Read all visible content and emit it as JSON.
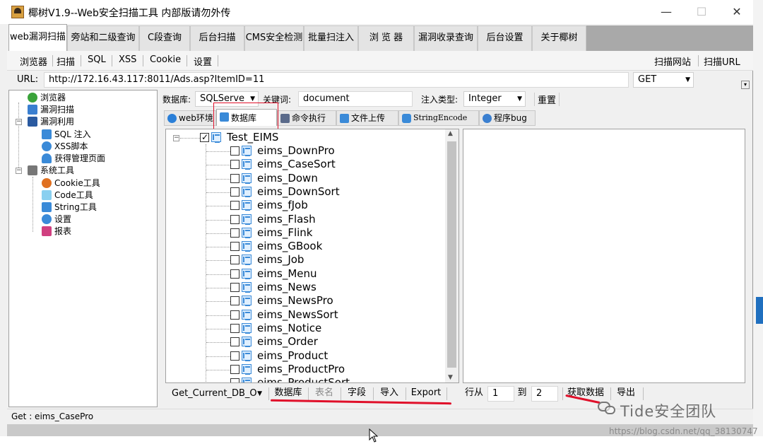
{
  "window": {
    "title": "椰树V1.9--Web安全扫描工具 内部版请勿外传",
    "minimize": "—",
    "maximize": "☐",
    "close": "✕"
  },
  "main_tabs": [
    {
      "label": "web漏洞扫描",
      "active": true
    },
    {
      "label": "旁站和二级查询"
    },
    {
      "label": "C段查询"
    },
    {
      "label": "后台扫描"
    },
    {
      "label": "CMS安全检测"
    },
    {
      "label": "批量扫注入"
    },
    {
      "label": "浏 览 器"
    },
    {
      "label": "漏洞收录查询"
    },
    {
      "label": "后台设置"
    },
    {
      "label": "关于椰树"
    }
  ],
  "toolbar": {
    "items": [
      "浏览器",
      "扫描",
      "SQL",
      "XSS",
      "Cookie",
      "设置"
    ],
    "right_items": [
      "扫描网站",
      "扫描URL"
    ]
  },
  "url_row": {
    "label": "URL:",
    "value": "http://172.16.43.117:8011/Ads.asp?ItemID=11",
    "method": "GET"
  },
  "nav_tree": {
    "items": [
      {
        "label": "浏览器",
        "icon": "check-circle-icon",
        "color": "#3aa33a"
      },
      {
        "label": "漏洞扫描",
        "icon": "scan-icon",
        "color": "#3a7fd0"
      },
      {
        "label": "漏洞利用",
        "icon": "exploit-icon",
        "color": "#2a5aa0"
      },
      {
        "label": "SQL 注入",
        "icon": "database-icon",
        "color": "#3a8ad8"
      },
      {
        "label": "XSS脚本",
        "icon": "xss-icon",
        "color": "#3a8ad8"
      },
      {
        "label": "获得管理页面",
        "icon": "user-icon",
        "color": "#3a8ad8"
      },
      {
        "label": "系统工具",
        "icon": "tools-icon",
        "color": "#666666"
      },
      {
        "label": "Cookie工具",
        "icon": "cookie-icon",
        "color": "#e07020"
      },
      {
        "label": "Code工具",
        "icon": "code-icon",
        "color": "#8ad0f0"
      },
      {
        "label": "String工具",
        "icon": "string-icon",
        "color": "#3a8ad8"
      },
      {
        "label": "设置",
        "icon": "gear-icon",
        "color": "#3a8ad8"
      },
      {
        "label": "报表",
        "icon": "report-icon",
        "color": "#d04080"
      }
    ]
  },
  "query_bar": {
    "db_label": "数据库:",
    "db_value": "SQLServe",
    "keyword_label": "关键词:",
    "keyword_value": "document",
    "inject_label": "注入类型:",
    "inject_value": "Integer",
    "reset_label": "重置"
  },
  "sub_tabs": [
    {
      "label": "web环境",
      "icon": "info-icon"
    },
    {
      "label": "数据库",
      "icon": "database-icon",
      "active": true
    },
    {
      "label": "命令执行",
      "icon": "terminal-icon"
    },
    {
      "label": "文件上传",
      "icon": "upload-icon"
    },
    {
      "label": "StringEncode",
      "icon": "encode-icon"
    },
    {
      "label": "程序bug",
      "icon": "bug-icon"
    }
  ],
  "db_tree": {
    "root": "Test_EIMS",
    "tables": [
      "eims_DownPro",
      "eims_CaseSort",
      "eims_Down",
      "eims_DownSort",
      "eims_fJob",
      "eims_Flash",
      "eims_Flink",
      "eims_GBook",
      "eims_Job",
      "eims_Menu",
      "eims_News",
      "eims_NewsPro",
      "eims_NewsSort",
      "eims_Notice",
      "eims_Order",
      "eims_Product",
      "eims_ProductPro",
      "eims_ProductSort"
    ]
  },
  "bottom_bar": {
    "mode_value": "Get_Current_DB_O",
    "buttons": [
      "数据库",
      "表名",
      "字段",
      "导入",
      "Export"
    ],
    "row_from_label": "行从",
    "row_from": "1",
    "row_to_label": "到",
    "row_to": "2",
    "fetch_label": "获取数据",
    "export_label": "导出"
  },
  "status": {
    "text": "Get : eims_CasePro"
  },
  "watermark": {
    "brand": "Tide安全团队",
    "url": "https://blog.csdn.net/qq_38130747"
  },
  "colors": {
    "accent_red": "#e0102a",
    "selection_blue": "#3a8ad8"
  }
}
